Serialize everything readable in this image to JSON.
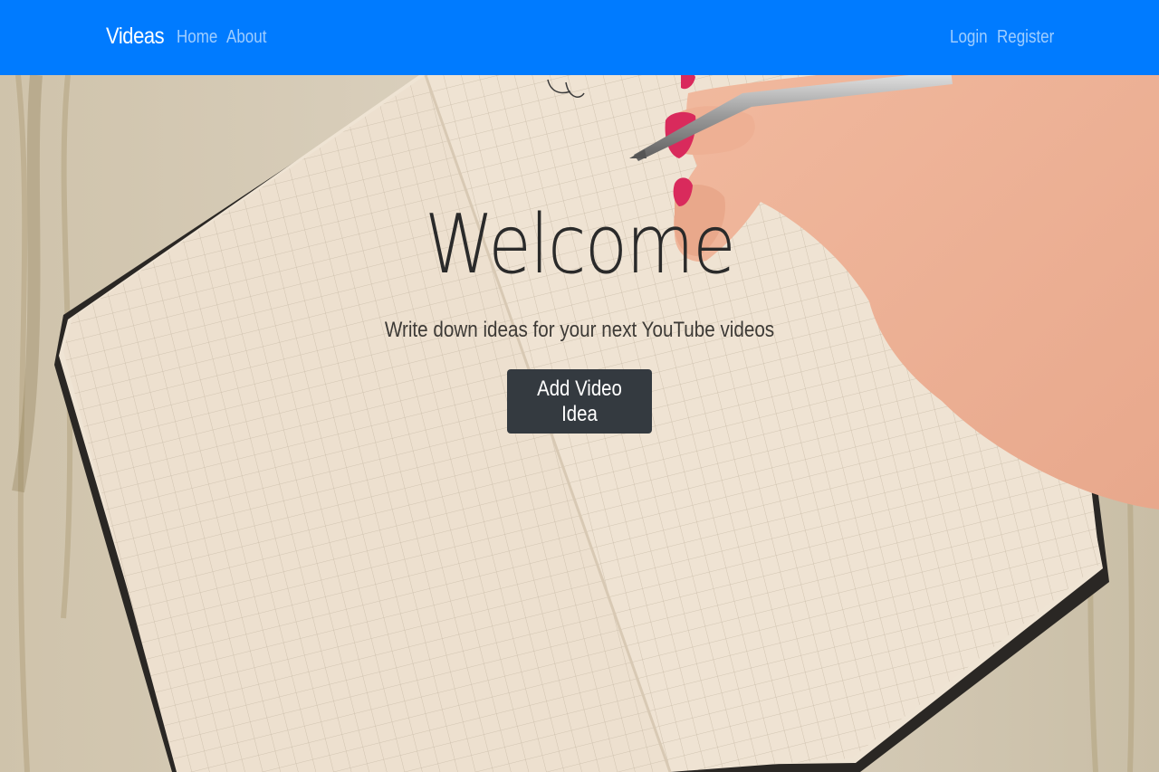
{
  "navbar": {
    "brand": "Videas",
    "links_left": [
      "Home",
      "About"
    ],
    "links_right": [
      "Login",
      "Register"
    ],
    "background_color": "#007bff"
  },
  "hero": {
    "title": "Welcome",
    "subtitle": "Write down ideas for your next YouTube videos",
    "cta_label": "Add Video Idea",
    "cta_color": "#343a40"
  },
  "background_image": "notebook-with-hand-writing-on-wooden-desk"
}
